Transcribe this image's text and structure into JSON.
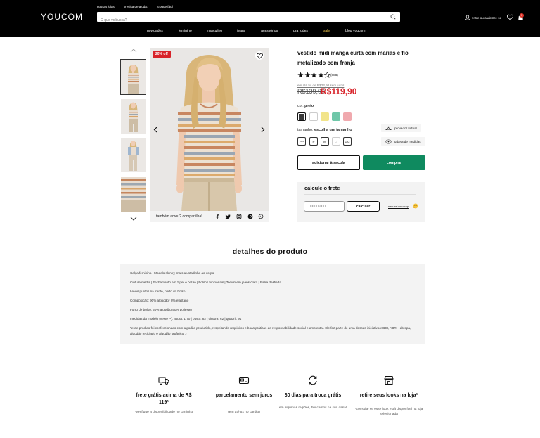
{
  "header": {
    "logo": "YOUCOM",
    "top_links": [
      "nossas lojas",
      "precisa de ajuda?",
      "troque fácil"
    ],
    "search_placeholder": "O que vc busca?",
    "account_label": "entre ou cadastre-se",
    "bag_count": "0",
    "nav": [
      "novidades",
      "feminino",
      "masculino",
      "jeans",
      "acessórios",
      "pra todes",
      "sale",
      "blog youcom"
    ]
  },
  "gallery": {
    "badge": "20% off",
    "share_label": "também amou? compartilha!",
    "social_icons": [
      "facebook-icon",
      "twitter-icon",
      "instagram-icon",
      "pinterest-icon",
      "whatsapp-icon"
    ]
  },
  "product": {
    "title": "vestido midi manga curta com marias e fio metalizado com franja",
    "rating": 4,
    "rating_count": "(888)",
    "installments": "em até 5x de R$23,98 sem juros",
    "old_price": "R$139,90",
    "new_price": "R$119,90",
    "color_label": "cor:",
    "color_value": "preto",
    "colors": [
      "#3a3a3a",
      "#ffffff",
      "#f2e48a",
      "#6fc7a9",
      "#f0a9ae"
    ],
    "size_label": "tamanho:",
    "size_value": "escolha um tamanho",
    "sizes": [
      "PP",
      "P",
      "M",
      "G",
      "GG"
    ],
    "virtual_fitter": "provador virtual",
    "size_chart": "tabela de medidas",
    "add_to_bag": "adicionar à sacola",
    "buy": "comprar"
  },
  "shipping": {
    "title": "calcule o frete",
    "cep_placeholder": "00000-000",
    "calc_button": "calcular",
    "dont_know_cep": "nem sei meu cep"
  },
  "details": {
    "title": "detalhes do produto",
    "lines": [
      "Calça feminina | Modelo skinny, mais ajustadinho ao corpo",
      "Cintura média | Fechamento em zíper e botão | Bolsos funcionais | Tecido em jeans claro | Barra desfiada",
      "Leves puídos na frente, perto do bolso",
      "Composição: 90% algodão* 8% elastano",
      "Forro de bolso: 50% algodão 50% poliéster",
      "medidas da modelo (veste P): altura: 1.70 | busto: 82 | cintura: 62 | quadril: 91",
      "*esse produto foi confeccionado com algodão produzido,  respeitando requisitos e boas práticas de responsabilidade  social e ambiental. Ele faz parte de uma dessas iniciativas: BCI, ABR – abrapa, algodão reciclado e algodão orgânico ;)"
    ]
  },
  "features": [
    {
      "icon": "truck-icon",
      "title": "frete grátis acima de R$ 119*",
      "sub": "*verifique a disponibilidade no carrinho"
    },
    {
      "icon": "card-icon",
      "title": "parcelamento sem juros",
      "sub": "(em até 5x no cartão)"
    },
    {
      "icon": "exchange-icon",
      "title": "30 dias para troca grátis",
      "sub": "em algumas regiões, buscamos na sua casa!"
    },
    {
      "icon": "store-icon",
      "title": "retire seus looks na loja*",
      "sub": "*consulte se esse look está disponível na loja selecionada"
    }
  ]
}
